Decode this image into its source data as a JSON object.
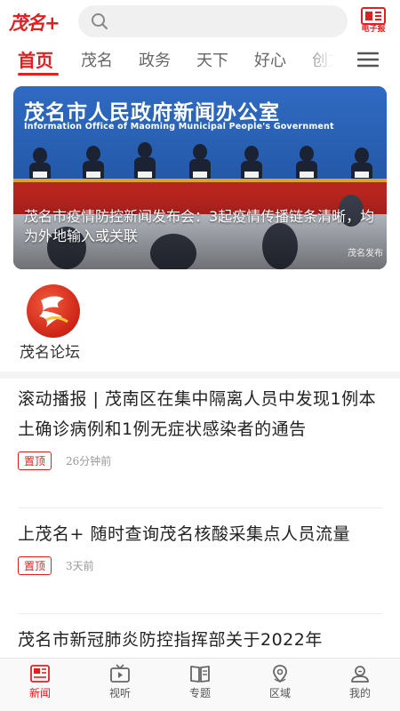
{
  "header": {
    "logo": "茂名+",
    "epaper_label": "电子报"
  },
  "tabs": [
    {
      "label": "首页",
      "active": true
    },
    {
      "label": "茂名"
    },
    {
      "label": "政务"
    },
    {
      "label": "天下"
    },
    {
      "label": "好心"
    },
    {
      "label": "创文"
    }
  ],
  "banner": {
    "title": "茂名市人民政府新闻办公室",
    "subtitle": "Information Office of Maoming Municipal People's Government",
    "caption": "茂名市疫情防控新闻发布会：3起疫情传播链条清晰，均为外地输入或关联",
    "watermark": "茂名发布"
  },
  "forum": {
    "label": "茂名论坛"
  },
  "news": [
    {
      "title": "滚动播报 | 茂南区在集中隔离人员中发现1例本土确诊病例和1例无症状感染者的通告",
      "badge": "置顶",
      "time": "26分钟前"
    },
    {
      "title": "上茂名+  随时查询茂名核酸采集点人员流量",
      "badge": "置顶",
      "time": "3天前"
    },
    {
      "title": "茂名市新冠肺炎防控指挥部关于2022年"
    }
  ],
  "bottom_nav": [
    {
      "label": "新闻",
      "icon": "news-icon",
      "active": true
    },
    {
      "label": "视听",
      "icon": "tv-icon"
    },
    {
      "label": "专题",
      "icon": "book-icon"
    },
    {
      "label": "区域",
      "icon": "location-icon"
    },
    {
      "label": "我的",
      "icon": "user-icon"
    }
  ],
  "colors": {
    "accent": "#e02020",
    "banner_blue": "#1c4a8f"
  }
}
